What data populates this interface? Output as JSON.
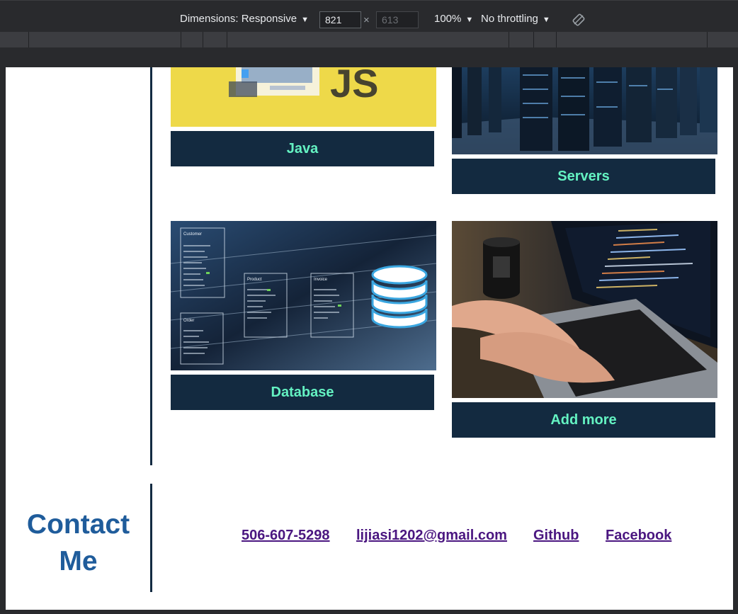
{
  "devtools": {
    "dimensions_label": "Dimensions: Responsive",
    "width": "821",
    "height": "613",
    "zoom": "100%",
    "throttling": "No throttling",
    "rotate_icon": "rotate-icon"
  },
  "skills": {
    "cards": [
      {
        "label": "Java",
        "image": "javascript-image"
      },
      {
        "label": "Servers",
        "image": "servers-image"
      },
      {
        "label": "Database",
        "image": "database-image"
      },
      {
        "label": "Add more",
        "image": "laptop-coding-image"
      }
    ]
  },
  "contact": {
    "title": "Contact Me",
    "phone": "506-607-5298",
    "email": "lijiasi1202@gmail.com",
    "github": "Github",
    "facebook": "Facebook"
  },
  "colors": {
    "label_bg": "#132a40",
    "label_text": "#64f2c2",
    "contact_title": "#1f5c9b",
    "link": "#4a1680",
    "divider": "#132b42"
  }
}
